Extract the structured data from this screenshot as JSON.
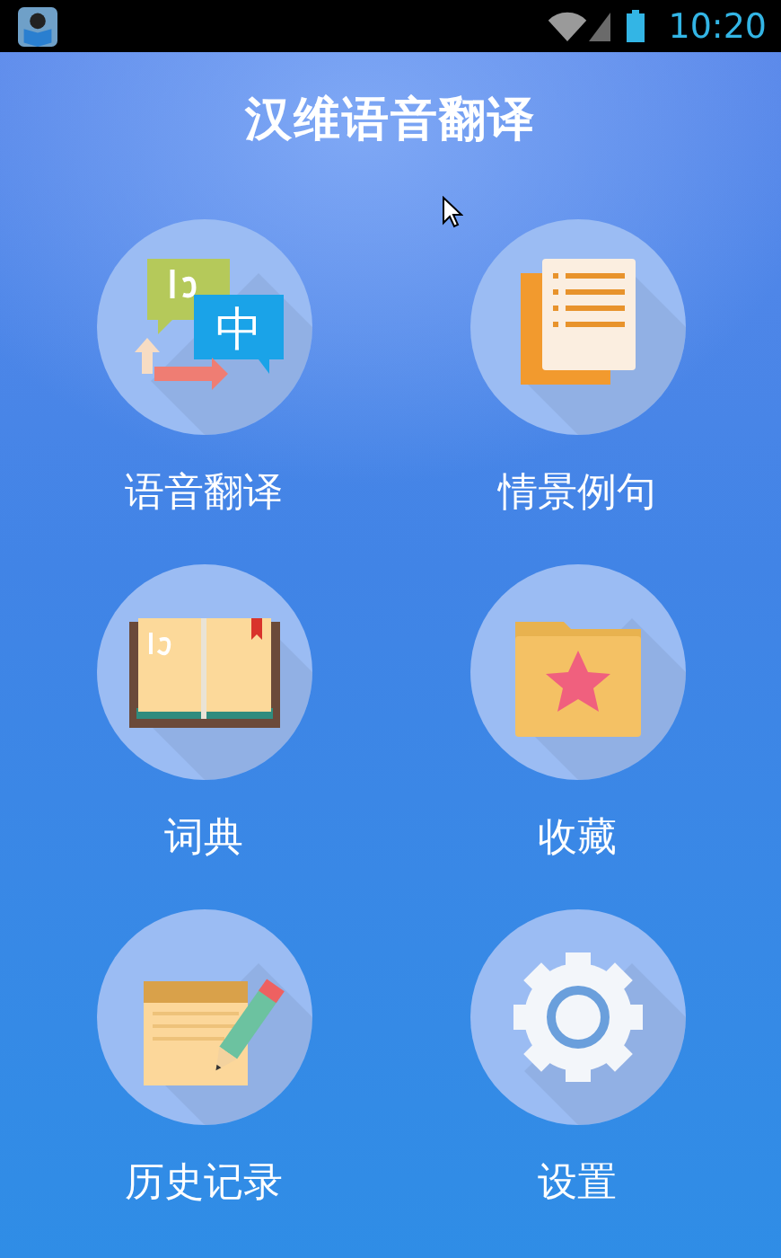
{
  "status_bar": {
    "time": "10:20"
  },
  "title": "汉维语音翻译",
  "menu": [
    {
      "kind": "translate",
      "label": "语音翻译",
      "icon_text": "中"
    },
    {
      "kind": "phrases",
      "label": "情景例句"
    },
    {
      "kind": "dictionary",
      "label": "词典"
    },
    {
      "kind": "favorites",
      "label": "收藏"
    },
    {
      "kind": "history",
      "label": "历史记录"
    },
    {
      "kind": "settings",
      "label": "设置"
    }
  ]
}
